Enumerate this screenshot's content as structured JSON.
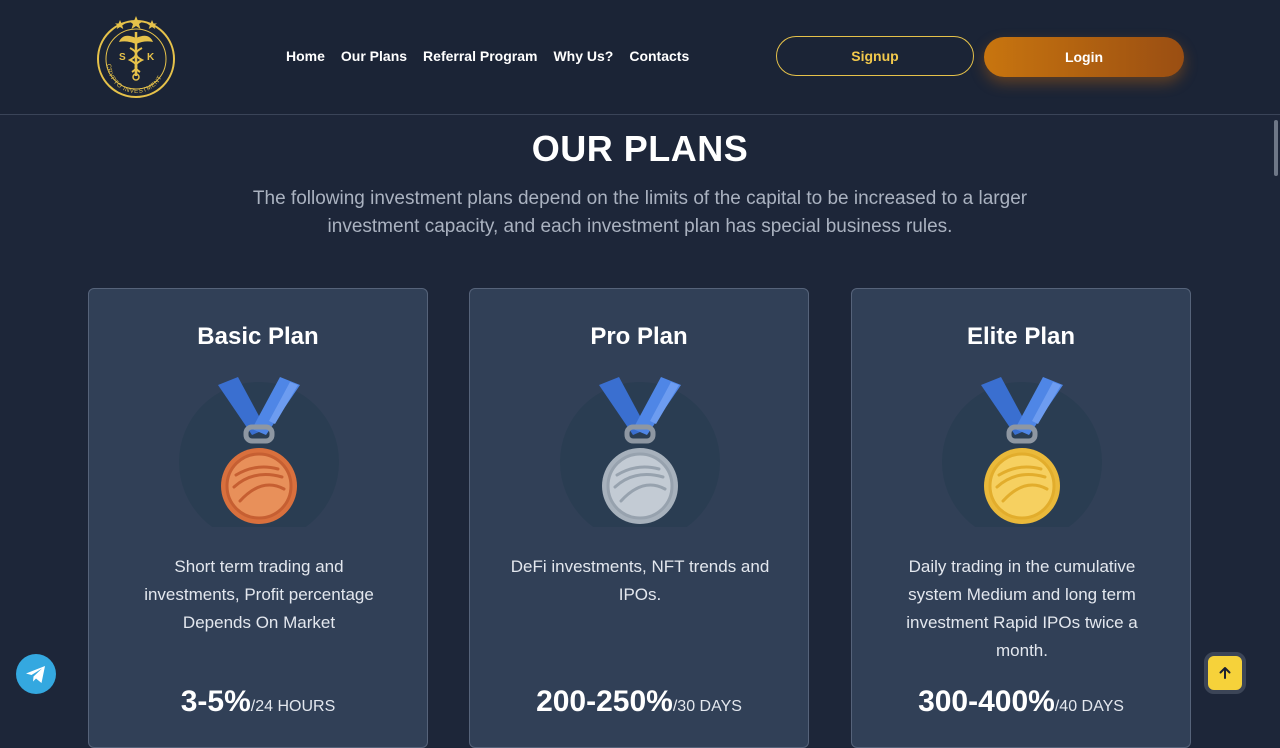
{
  "brand": {
    "logo_letters": [
      "S",
      "K"
    ],
    "logo_ring_text": "CRYPTO INVESTMENT"
  },
  "nav": {
    "items": [
      {
        "label": "Home"
      },
      {
        "label": "Our Plans"
      },
      {
        "label": "Referral Program"
      },
      {
        "label": "Why Us?"
      },
      {
        "label": "Contacts"
      }
    ]
  },
  "auth": {
    "signup_label": "Signup",
    "login_label": "Login"
  },
  "section": {
    "title": "OUR PLANS",
    "description": "The following investment plans depend on the limits of the capital to be increased to a larger investment capacity, and each investment plan has special business rules."
  },
  "plans": [
    {
      "title": "Basic Plan",
      "medal": "bronze-medal-icon",
      "description": "Short term trading and investments, Profit percentage Depends On Market",
      "amount": "3-5%",
      "period": "/24 HOURS"
    },
    {
      "title": "Pro Plan",
      "medal": "silver-medal-icon",
      "description": "DeFi investments, NFT trends and IPOs.",
      "amount": "200-250%",
      "period": "/30 DAYS"
    },
    {
      "title": "Elite Plan",
      "medal": "gold-medal-icon",
      "description": "Daily trading in the cumulative system Medium and long term investment Rapid IPOs twice a month.",
      "amount": "300-400%",
      "period": "/40 DAYS"
    }
  ],
  "colors": {
    "accent_gold": "#f2c94c",
    "login_gradient_start": "#c8750f",
    "login_gradient_end": "#9a4e12",
    "bronze": "#e0844e",
    "silver": "#b3bcc6",
    "gold": "#f2c74c",
    "telegram": "#34a8e0"
  },
  "floating": {
    "telegram_icon": "telegram-icon",
    "back_to_top_icon": "arrow-up-icon"
  }
}
